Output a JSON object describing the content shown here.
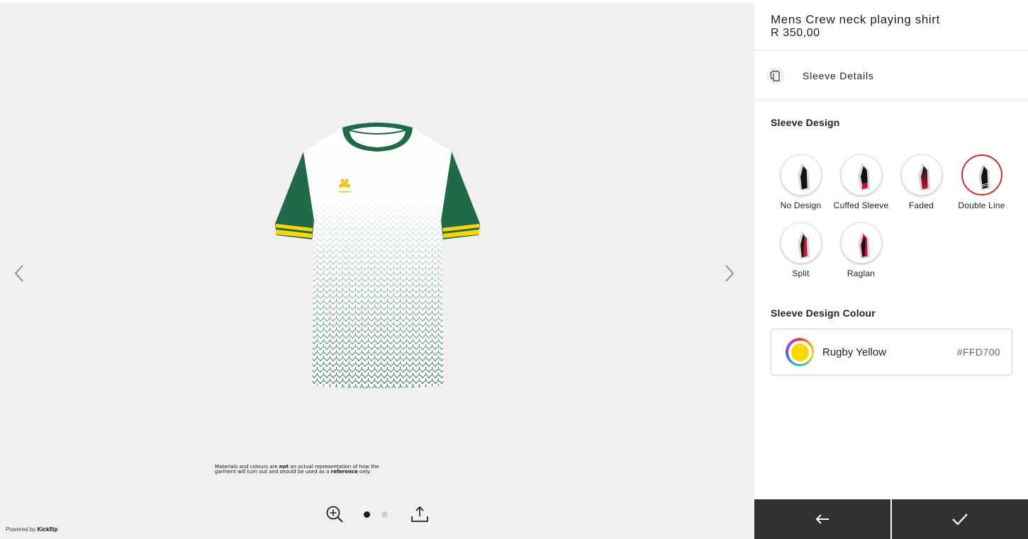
{
  "viewer": {
    "disclaimer": {
      "part1": "Materials and colours are ",
      "bold1": "not",
      "part2": " an actual representation of how the garment will turn out and should be used as a ",
      "bold2": "reference",
      "part3": " only."
    },
    "shirt_colors": {
      "body": "#ffffff",
      "sleeve": "#216a47",
      "collar": "#1c6a46",
      "pattern": "#1d6e4a",
      "trim": "#ffd700"
    },
    "pagination": {
      "current": 1,
      "total": 2
    },
    "powered_by": {
      "prefix": "Powered by ",
      "brand": "Kickflip"
    }
  },
  "panel": {
    "product": {
      "title": "Mens Crew neck playing shirt",
      "price": "R 350,00"
    },
    "section": {
      "label": "Sleeve Details",
      "icon": "shirt-sleeve-icon"
    },
    "sleeve_design": {
      "label": "Sleeve Design",
      "selected": "Double Line",
      "options": [
        {
          "label": "No Design",
          "accent": "#111111"
        },
        {
          "label": "Cuffed Sleeve",
          "accent": "#c8143c"
        },
        {
          "label": "Faded",
          "accent": "#c8143c"
        },
        {
          "label": "Double Line",
          "accent": "#111111"
        },
        {
          "label": "Split",
          "accent": "#c8143c"
        },
        {
          "label": "Raglan",
          "accent": "#c8143c"
        }
      ]
    },
    "sleeve_colour": {
      "label": "Sleeve Design Colour",
      "name": "Rugby Yellow",
      "hex": "#FFD700"
    },
    "actions": {
      "back_icon": "arrow-left-icon",
      "confirm_icon": "checkmark-icon"
    }
  }
}
